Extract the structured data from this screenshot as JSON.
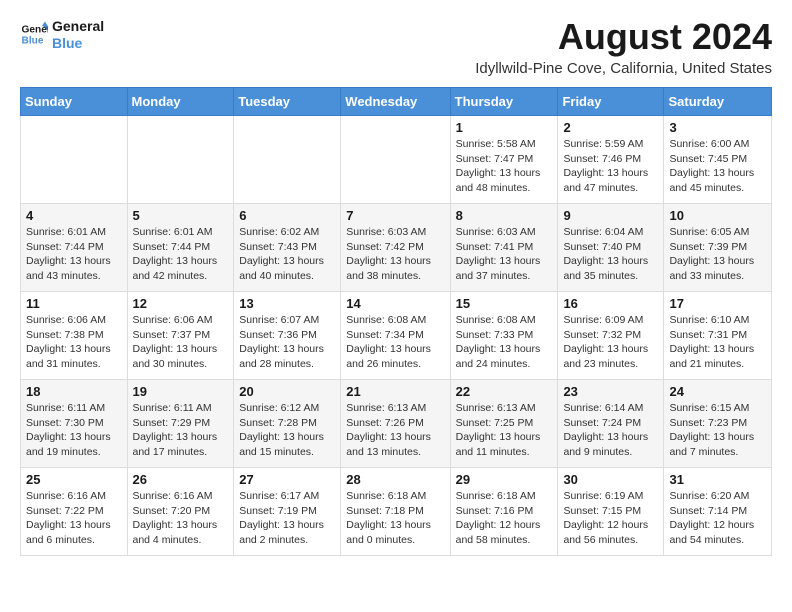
{
  "logo": {
    "line1": "General",
    "line2": "Blue"
  },
  "title": {
    "month_year": "August 2024",
    "location": "Idyllwild-Pine Cove, California, United States"
  },
  "headers": [
    "Sunday",
    "Monday",
    "Tuesday",
    "Wednesday",
    "Thursday",
    "Friday",
    "Saturday"
  ],
  "weeks": [
    [
      {
        "day": "",
        "info": ""
      },
      {
        "day": "",
        "info": ""
      },
      {
        "day": "",
        "info": ""
      },
      {
        "day": "",
        "info": ""
      },
      {
        "day": "1",
        "info": "Sunrise: 5:58 AM\nSunset: 7:47 PM\nDaylight: 13 hours\nand 48 minutes."
      },
      {
        "day": "2",
        "info": "Sunrise: 5:59 AM\nSunset: 7:46 PM\nDaylight: 13 hours\nand 47 minutes."
      },
      {
        "day": "3",
        "info": "Sunrise: 6:00 AM\nSunset: 7:45 PM\nDaylight: 13 hours\nand 45 minutes."
      }
    ],
    [
      {
        "day": "4",
        "info": "Sunrise: 6:01 AM\nSunset: 7:44 PM\nDaylight: 13 hours\nand 43 minutes."
      },
      {
        "day": "5",
        "info": "Sunrise: 6:01 AM\nSunset: 7:44 PM\nDaylight: 13 hours\nand 42 minutes."
      },
      {
        "day": "6",
        "info": "Sunrise: 6:02 AM\nSunset: 7:43 PM\nDaylight: 13 hours\nand 40 minutes."
      },
      {
        "day": "7",
        "info": "Sunrise: 6:03 AM\nSunset: 7:42 PM\nDaylight: 13 hours\nand 38 minutes."
      },
      {
        "day": "8",
        "info": "Sunrise: 6:03 AM\nSunset: 7:41 PM\nDaylight: 13 hours\nand 37 minutes."
      },
      {
        "day": "9",
        "info": "Sunrise: 6:04 AM\nSunset: 7:40 PM\nDaylight: 13 hours\nand 35 minutes."
      },
      {
        "day": "10",
        "info": "Sunrise: 6:05 AM\nSunset: 7:39 PM\nDaylight: 13 hours\nand 33 minutes."
      }
    ],
    [
      {
        "day": "11",
        "info": "Sunrise: 6:06 AM\nSunset: 7:38 PM\nDaylight: 13 hours\nand 31 minutes."
      },
      {
        "day": "12",
        "info": "Sunrise: 6:06 AM\nSunset: 7:37 PM\nDaylight: 13 hours\nand 30 minutes."
      },
      {
        "day": "13",
        "info": "Sunrise: 6:07 AM\nSunset: 7:36 PM\nDaylight: 13 hours\nand 28 minutes."
      },
      {
        "day": "14",
        "info": "Sunrise: 6:08 AM\nSunset: 7:34 PM\nDaylight: 13 hours\nand 26 minutes."
      },
      {
        "day": "15",
        "info": "Sunrise: 6:08 AM\nSunset: 7:33 PM\nDaylight: 13 hours\nand 24 minutes."
      },
      {
        "day": "16",
        "info": "Sunrise: 6:09 AM\nSunset: 7:32 PM\nDaylight: 13 hours\nand 23 minutes."
      },
      {
        "day": "17",
        "info": "Sunrise: 6:10 AM\nSunset: 7:31 PM\nDaylight: 13 hours\nand 21 minutes."
      }
    ],
    [
      {
        "day": "18",
        "info": "Sunrise: 6:11 AM\nSunset: 7:30 PM\nDaylight: 13 hours\nand 19 minutes."
      },
      {
        "day": "19",
        "info": "Sunrise: 6:11 AM\nSunset: 7:29 PM\nDaylight: 13 hours\nand 17 minutes."
      },
      {
        "day": "20",
        "info": "Sunrise: 6:12 AM\nSunset: 7:28 PM\nDaylight: 13 hours\nand 15 minutes."
      },
      {
        "day": "21",
        "info": "Sunrise: 6:13 AM\nSunset: 7:26 PM\nDaylight: 13 hours\nand 13 minutes."
      },
      {
        "day": "22",
        "info": "Sunrise: 6:13 AM\nSunset: 7:25 PM\nDaylight: 13 hours\nand 11 minutes."
      },
      {
        "day": "23",
        "info": "Sunrise: 6:14 AM\nSunset: 7:24 PM\nDaylight: 13 hours\nand 9 minutes."
      },
      {
        "day": "24",
        "info": "Sunrise: 6:15 AM\nSunset: 7:23 PM\nDaylight: 13 hours\nand 7 minutes."
      }
    ],
    [
      {
        "day": "25",
        "info": "Sunrise: 6:16 AM\nSunset: 7:22 PM\nDaylight: 13 hours\nand 6 minutes."
      },
      {
        "day": "26",
        "info": "Sunrise: 6:16 AM\nSunset: 7:20 PM\nDaylight: 13 hours\nand 4 minutes."
      },
      {
        "day": "27",
        "info": "Sunrise: 6:17 AM\nSunset: 7:19 PM\nDaylight: 13 hours\nand 2 minutes."
      },
      {
        "day": "28",
        "info": "Sunrise: 6:18 AM\nSunset: 7:18 PM\nDaylight: 13 hours\nand 0 minutes."
      },
      {
        "day": "29",
        "info": "Sunrise: 6:18 AM\nSunset: 7:16 PM\nDaylight: 12 hours\nand 58 minutes."
      },
      {
        "day": "30",
        "info": "Sunrise: 6:19 AM\nSunset: 7:15 PM\nDaylight: 12 hours\nand 56 minutes."
      },
      {
        "day": "31",
        "info": "Sunrise: 6:20 AM\nSunset: 7:14 PM\nDaylight: 12 hours\nand 54 minutes."
      }
    ]
  ]
}
